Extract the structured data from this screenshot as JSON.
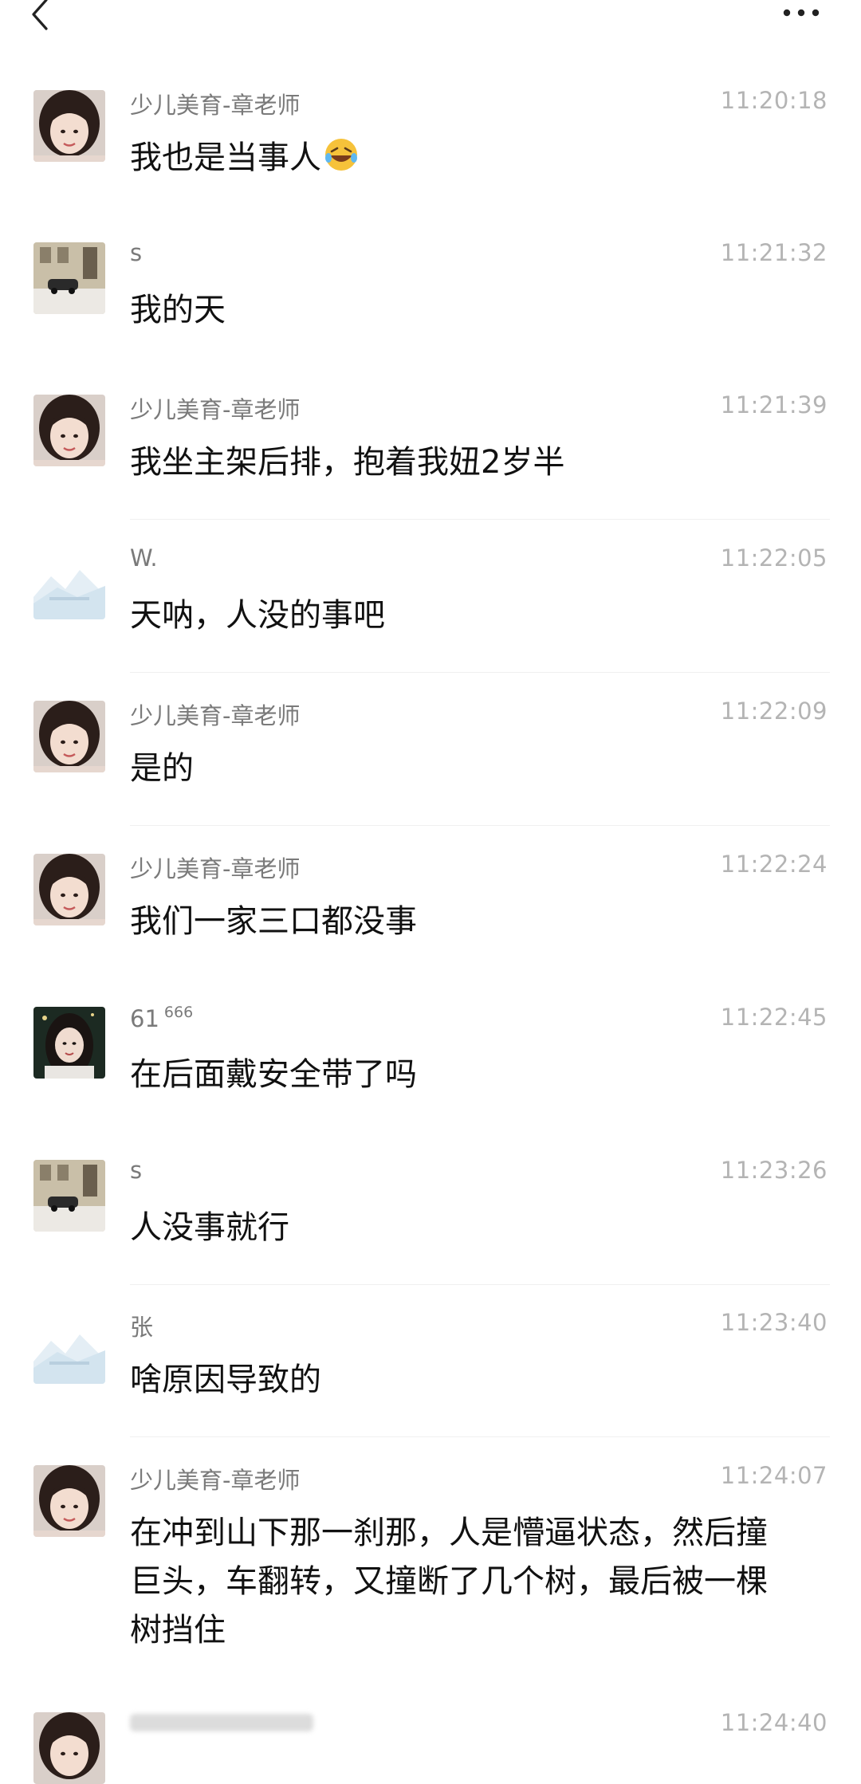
{
  "nav": {
    "back_icon": "chevron-left-icon",
    "more_icon": "more-horizontal-icon"
  },
  "messages": [
    {
      "sender": "少儿美育-章老师",
      "time": "11:20:18",
      "text": "我也是当事人",
      "avatar": "teacher-photo",
      "emoji": "laughing-crying-emoji"
    },
    {
      "sender": "s",
      "time": "11:21:32",
      "text": "我的天",
      "avatar": "street-car-photo"
    },
    {
      "sender": "少儿美育-章老师",
      "time": "11:21:39",
      "text": "我坐主架后排，抱着我妞2岁半",
      "avatar": "teacher-photo"
    },
    {
      "sender": "W.",
      "time": "11:22:05",
      "text": "天呐，人没的事吧",
      "avatar": "mountain-illustration"
    },
    {
      "sender": "少儿美育-章老师",
      "time": "11:22:09",
      "text": "是的",
      "avatar": "teacher-photo"
    },
    {
      "sender": "少儿美育-章老师",
      "time": "11:22:24",
      "text": "我们一家三口都没事",
      "avatar": "teacher-photo"
    },
    {
      "sender": "61",
      "sender_sup": "666",
      "time": "11:22:45",
      "text": "在后面戴安全带了吗",
      "avatar": "woman-portrait-dark"
    },
    {
      "sender": "s",
      "time": "11:23:26",
      "text": "人没事就行",
      "avatar": "street-car-photo"
    },
    {
      "sender": "张",
      "time": "11:23:40",
      "text": "啥原因导致的",
      "avatar": "mountain-illustration"
    },
    {
      "sender": "少儿美育-章老师",
      "time": "11:24:07",
      "text_lines": [
        "在冲到山下那一刹那，人是懵逼状态，然后撞",
        "巨头，车翻转，又撞断了几个树，最后被一棵",
        "树挡住"
      ],
      "avatar": "teacher-photo"
    },
    {
      "sender": "",
      "time": "11:24:40",
      "avatar": "teacher-photo"
    }
  ]
}
